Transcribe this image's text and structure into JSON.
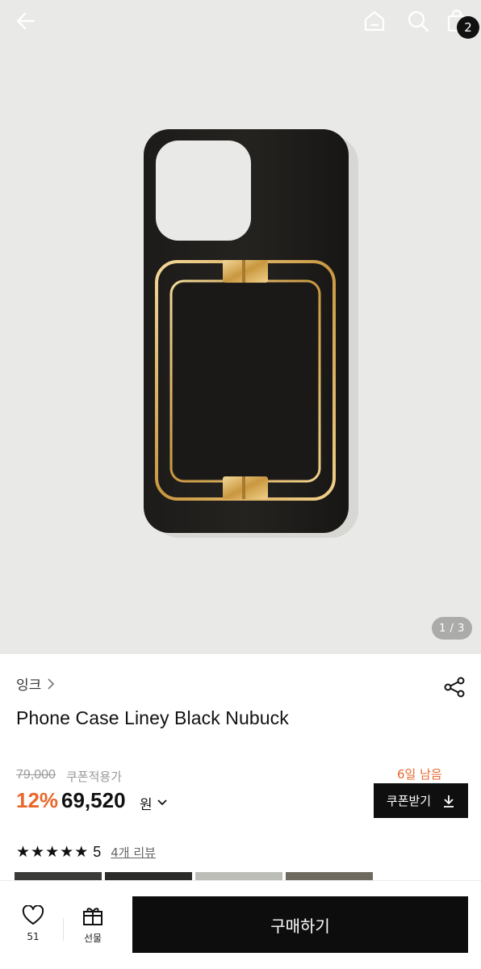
{
  "nav": {
    "cart_count": "2"
  },
  "gallery": {
    "pager": "1 / 3"
  },
  "product": {
    "brand": "잉크",
    "title": "Phone Case Liney Black Nubuck",
    "original_price": "79,000",
    "coupon_label": "쿠폰적용가",
    "discount": "12%",
    "price": "69,520",
    "currency": "원",
    "days_left": "6일 남음",
    "coupon_button": "쿠폰받기",
    "rating": "5",
    "review_link": "4개 리뷰"
  },
  "bottom": {
    "like_count": "51",
    "gift_label": "선물",
    "buy_label": "구매하기"
  },
  "colors": {
    "accent": "#e8672c",
    "dark": "#0d0d0d",
    "hero_bg": "#e9e9e7"
  }
}
